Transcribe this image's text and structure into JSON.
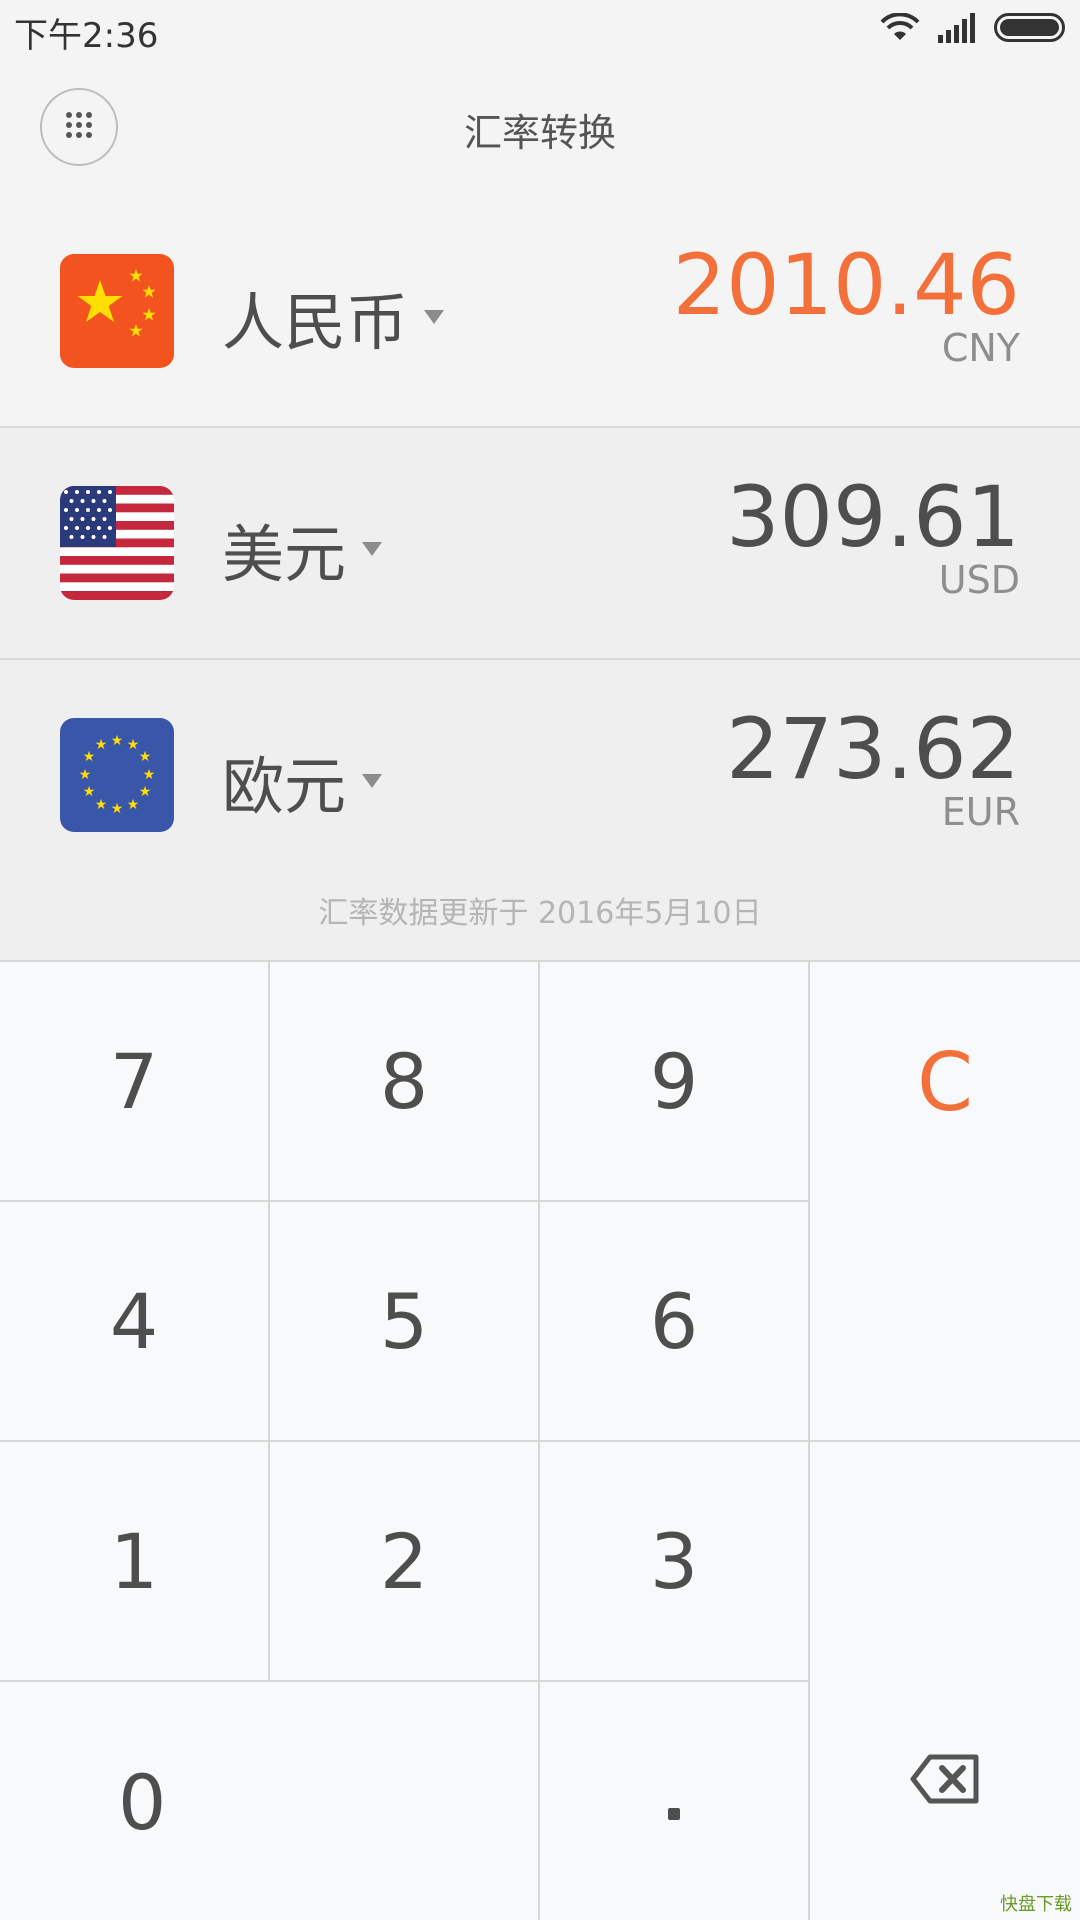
{
  "status_bar": {
    "time": "下午2:36",
    "icons": [
      "wifi-icon",
      "signal-icon",
      "battery-icon"
    ]
  },
  "header": {
    "title": "汇率转换",
    "menu_icon": "grid-dots-icon"
  },
  "currencies": [
    {
      "name": "人民币",
      "amount": "2010.46",
      "code": "CNY",
      "flag": "china-flag-icon",
      "active": true
    },
    {
      "name": "美元",
      "amount": "309.61",
      "code": "USD",
      "flag": "usa-flag-icon",
      "active": false
    },
    {
      "name": "欧元",
      "amount": "273.62",
      "code": "EUR",
      "flag": "eu-flag-icon",
      "active": false
    }
  ],
  "update_note": "汇率数据更新于 2016年5月10日",
  "keypad": {
    "digits": [
      "7",
      "8",
      "9",
      "4",
      "5",
      "6",
      "1",
      "2",
      "3",
      "0"
    ],
    "clear": "C",
    "decimal": ".",
    "backspace_icon": "backspace-icon"
  },
  "colors": {
    "accent": "#f4703a",
    "text": "#4e4e4e",
    "muted": "#8e8e8e"
  },
  "watermark": "快盘下载"
}
